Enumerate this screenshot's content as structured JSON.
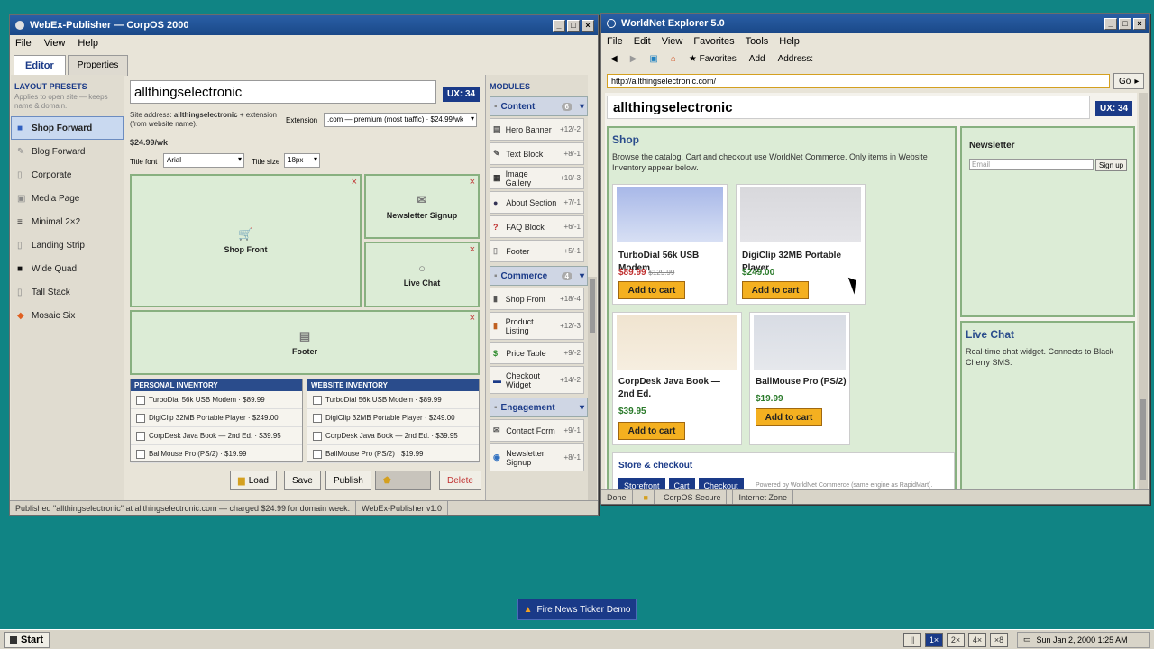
{
  "publisher": {
    "title": "WebEx-Publisher — CorpOS 2000",
    "menu": [
      "File",
      "View",
      "Help"
    ],
    "tabs": [
      "Editor",
      "Properties"
    ],
    "presets_heading": "LAYOUT PRESETS",
    "presets_note": "Applies to open site — keeps name & domain.",
    "presets": [
      {
        "label": "Shop Forward",
        "icon": "cart-icon"
      },
      {
        "label": "Blog Forward",
        "icon": "pencil-icon"
      },
      {
        "label": "Corporate",
        "icon": "building-icon"
      },
      {
        "label": "Media Page",
        "icon": "image-icon"
      },
      {
        "label": "Minimal 2×2",
        "icon": "grid-icon"
      },
      {
        "label": "Landing Strip",
        "icon": "strip-icon"
      },
      {
        "label": "Wide Quad",
        "icon": "square-icon"
      },
      {
        "label": "Tall Stack",
        "icon": "stack-icon"
      },
      {
        "label": "Mosaic Six",
        "icon": "diamond-icon"
      }
    ],
    "site_name": "allthingselectronic",
    "ux_badge": "UX: 34",
    "site_address_prefix": "Site address: ",
    "site_address_name": "allthingselectronic",
    "site_address_suffix": " + extension (from website name).",
    "extension_label": "Extension",
    "extension_value": ".com — premium (most traffic) · $24.99/wk",
    "price": "$24.99/wk",
    "title_font_label": "Title font",
    "title_font_value": "Arial",
    "title_size_label": "Title size",
    "title_size_value": "18px",
    "tiles": [
      {
        "label": "Shop Front",
        "icon": "cart-icon"
      },
      {
        "label": "Newsletter Signup",
        "icon": "mail-icon"
      },
      {
        "label": "Live Chat",
        "icon": "chat-icon"
      },
      {
        "label": "Footer",
        "icon": "document-icon"
      }
    ],
    "personal_inventory": {
      "heading": "PERSONAL INVENTORY",
      "items": [
        "TurboDial 56k USB Modem · $89.99",
        "DigiClip 32MB Portable Player · $249.00",
        "CorpDesk Java Book — 2nd Ed. · $39.95",
        "BallMouse Pro (PS/2) · $19.99"
      ]
    },
    "website_inventory": {
      "heading": "WEBSITE INVENTORY",
      "items": [
        "TurboDial 56k USB Modem · $89.99",
        "DigiClip 32MB Portable Player · $249.00",
        "CorpDesk Java Book — 2nd Ed. · $39.95",
        "BallMouse Pro (PS/2) · $19.99"
      ]
    },
    "actions": {
      "load": "Load",
      "save": "Save",
      "publish": "Publish",
      "delete": "Delete"
    },
    "modules_heading": "MODULES",
    "module_groups": [
      {
        "name": "Content",
        "count": "6",
        "items": [
          [
            "Hero Banner",
            "+12/-2"
          ],
          [
            "Text Block",
            "+8/-1"
          ],
          [
            "Image Gallery",
            "+10/-3"
          ],
          [
            "About Section",
            "+7/-1"
          ],
          [
            "FAQ Block",
            "+6/-1"
          ],
          [
            "Footer",
            "+5/-1"
          ]
        ]
      },
      {
        "name": "Commerce",
        "count": "4",
        "items": [
          [
            "Shop Front",
            "+18/-4"
          ],
          [
            "Product Listing",
            "+12/-3"
          ],
          [
            "Price Table",
            "+9/-2"
          ],
          [
            "Checkout Widget",
            "+14/-2"
          ]
        ]
      },
      {
        "name": "Engagement",
        "count": "",
        "items": [
          [
            "Contact Form",
            "+9/-1"
          ],
          [
            "Newsletter Signup",
            "+8/-1"
          ]
        ]
      }
    ],
    "status": "Published \"allthingselectronic\" at allthingselectronic.com — charged $24.99 for domain week.",
    "status_app": "WebEx-Publisher v1.0"
  },
  "browser": {
    "title": "WorldNet Explorer 5.0",
    "menu": [
      "File",
      "Edit",
      "View",
      "Favorites",
      "Tools",
      "Help"
    ],
    "toolbar": {
      "favorites": "★ Favorites",
      "add": "Add",
      "address": "Address:"
    },
    "url": "http://allthingselectronic.com/",
    "go": "Go",
    "site_title": "allthingselectronic",
    "ux_badge": "UX: 34",
    "shop_heading": "Shop",
    "shop_desc": "Browse the catalog. Cart and checkout use WorldNet Commerce. Only items in Website Inventory appear below.",
    "products": [
      {
        "name": "TurboDial 56k USB Modem",
        "price": "$89.99",
        "old_price": "$129.99",
        "add": "Add to cart"
      },
      {
        "name": "DigiClip 32MB Portable Player",
        "price": "$249.00",
        "add": "Add to cart"
      },
      {
        "name": "CorpDesk Java Book — 2nd Ed.",
        "price": "$39.95",
        "add": "Add to cart"
      },
      {
        "name": "BallMouse Pro (PS/2)",
        "price": "$19.99",
        "add": "Add to cart"
      }
    ],
    "store_heading": "Store & checkout",
    "store_tabs": [
      "Storefront",
      "Cart",
      "Checkout"
    ],
    "store_powered": "Powered by WorldNet Commerce (same engine as RapidMart).",
    "newsletter_heading": "Newsletter",
    "newsletter_placeholder": "Email",
    "signup": "Sign up",
    "chat_heading": "Live Chat",
    "chat_desc": "Real-time chat widget. Connects to Black Cherry SMS.",
    "status": [
      "Done",
      "CorpOS Secure",
      "Internet Zone"
    ]
  },
  "taskbar": {
    "start": "Start",
    "ticker_button": "Fire News Ticker Demo",
    "speeds": [
      "||",
      "1×",
      "2×",
      "4×",
      "×8"
    ],
    "clock": "Sun Jan 2, 2000  1:25 AM"
  }
}
